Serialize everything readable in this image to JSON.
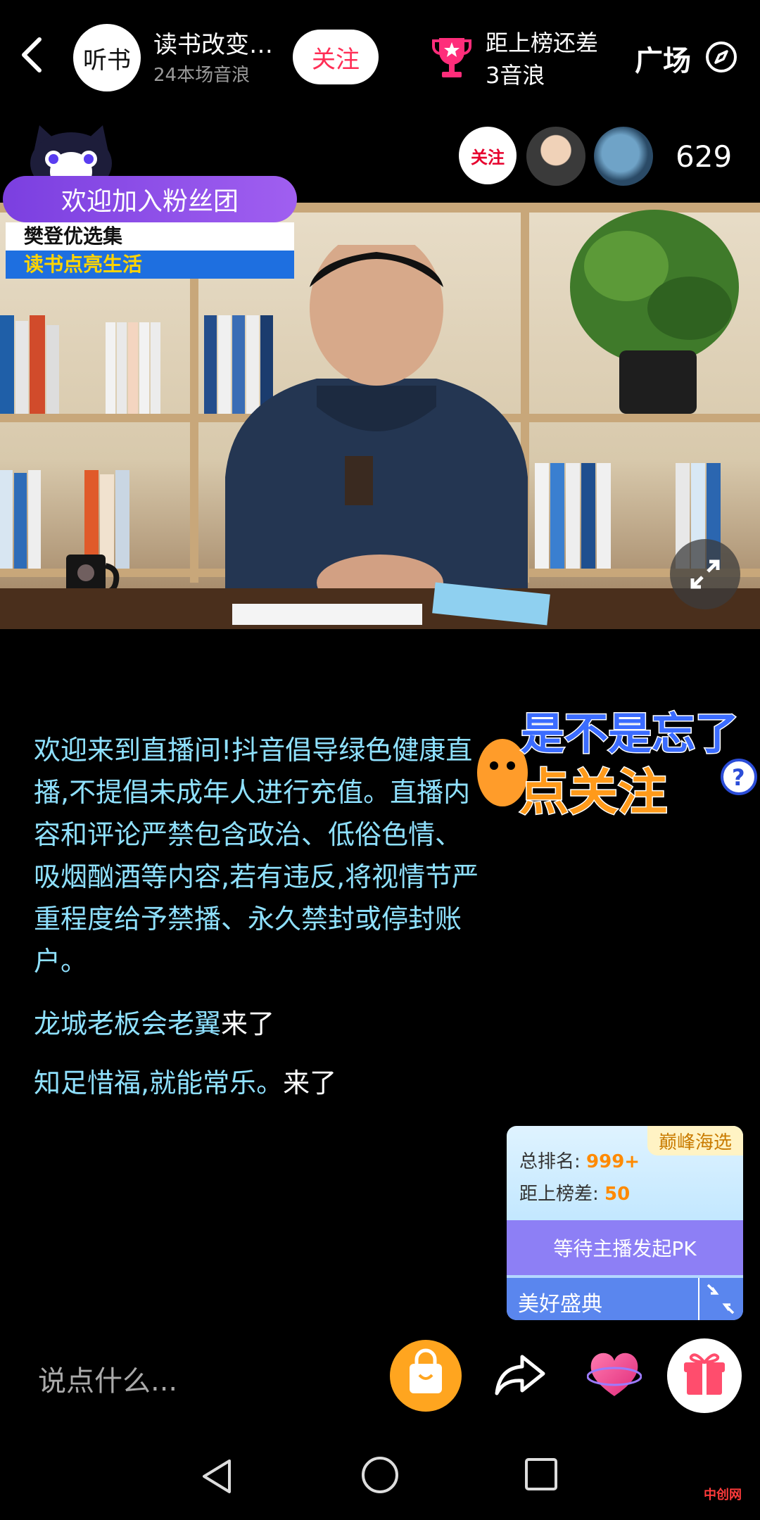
{
  "header": {
    "avatar_text": "听书",
    "host_name": "读书改变…",
    "host_sub": "24本场音浪",
    "follow_label": "关注",
    "rank_line1": "距上榜还差",
    "rank_line2": "3音浪",
    "plaza_label": "广场"
  },
  "audience": {
    "follow_label": "关注",
    "viewer_count": "629"
  },
  "fan_club": {
    "banner": "欢迎加入粉丝团",
    "tag1": "樊登优选集",
    "tag2": "读书点亮生活"
  },
  "chat": {
    "notice": "欢迎来到直播间!抖音倡导绿色健康直播,不提倡未成年人进行充值。直播内容和评论严禁包含政治、低俗色情、吸烟酗酒等内容,若有违反,将视情节严重程度给予禁播、永久禁封或停封账户。",
    "messages": [
      {
        "user": "龙城老板会老翼",
        "action": "来了"
      },
      {
        "user": "知足惜福,就能常乐。",
        "action": "来了"
      }
    ]
  },
  "sticker": {
    "line1": "是不是忘了",
    "line2": "点关注"
  },
  "pk_card": {
    "tag": "巅峰海选",
    "rank_label": "总排名:",
    "rank_value": "999+",
    "diff_label": "距上榜差:",
    "diff_value": "50",
    "wait_label": "等待主播发起PK",
    "gala_label": "美好盛典"
  },
  "bottom_bar": {
    "input_placeholder": "说点什么..."
  },
  "watermark": "中创网",
  "colors": {
    "accent_pink": "#ff2d55",
    "chat_blue": "#8fe1ff",
    "pk_purple": "#8d7ff5"
  }
}
